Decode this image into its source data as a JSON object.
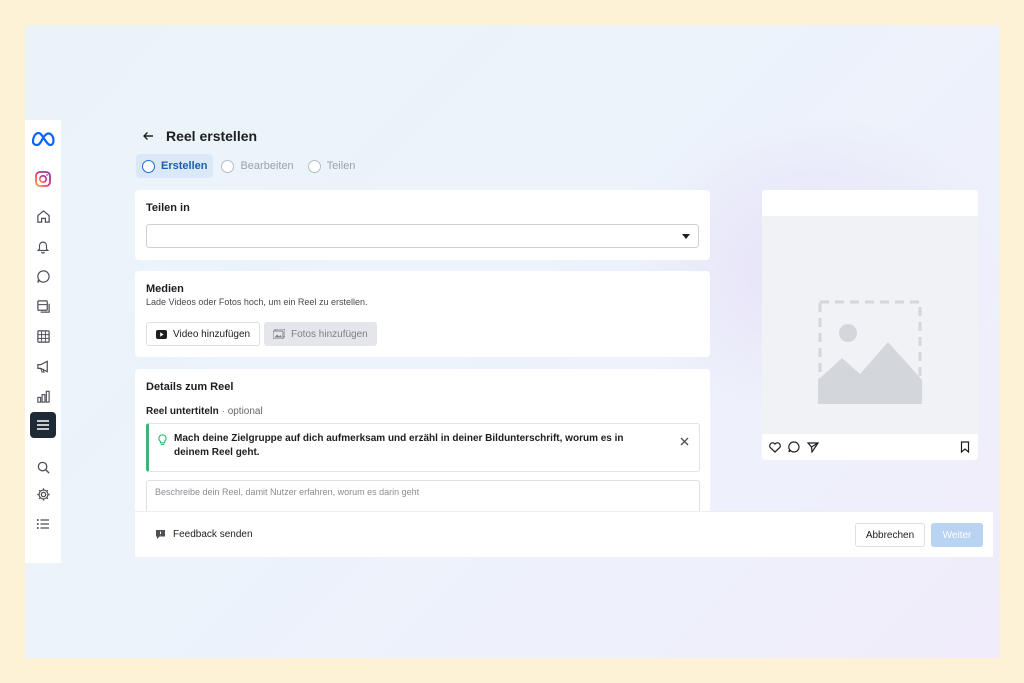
{
  "header": {
    "title": "Reel erstellen"
  },
  "steps": [
    {
      "label": "Erstellen",
      "active": true
    },
    {
      "label": "Bearbeiten",
      "active": false
    },
    {
      "label": "Teilen",
      "active": false
    }
  ],
  "share": {
    "title": "Teilen in",
    "selected_value": ""
  },
  "media": {
    "title": "Medien",
    "description": "Lade Videos oder Fotos hoch, um ein Reel zu erstellen.",
    "add_video_label": "Video hinzufügen",
    "add_photos_label": "Fotos hinzufügen"
  },
  "details": {
    "title": "Details zum Reel",
    "caption_label": "Reel untertiteln",
    "caption_optional": "optional",
    "tip_text": "Mach deine Zielgruppe auf dich aufmerksam und erzähl in deiner Bildunterschrift, worum es in deinem Reel geht.",
    "caption_placeholder": "Beschreibe dein Reel, damit Nutzer erfahren, worum es darin geht"
  },
  "footer": {
    "feedback_label": "Feedback senden",
    "cancel_label": "Abbrechen",
    "next_label": "Weiter"
  },
  "sidebar": {
    "items": [
      {
        "icon": "meta-logo-icon"
      },
      {
        "icon": "instagram-icon"
      },
      {
        "icon": "home-icon"
      },
      {
        "icon": "bell-icon"
      },
      {
        "icon": "chat-bubble-icon"
      },
      {
        "icon": "pages-icon"
      },
      {
        "icon": "table-icon"
      },
      {
        "icon": "megaphone-icon"
      },
      {
        "icon": "bar-chart-icon"
      },
      {
        "icon": "menu-icon",
        "active": true
      },
      {
        "icon": "search-icon"
      },
      {
        "icon": "gear-icon"
      },
      {
        "icon": "list-icon"
      }
    ]
  },
  "colors": {
    "page_bg": "#fdf1d6",
    "accent": "#1b6fd1",
    "active_step_bg": "#dbe8f7",
    "tip_border": "#3bb37a",
    "next_button_disabled": "#b9d3f2"
  }
}
